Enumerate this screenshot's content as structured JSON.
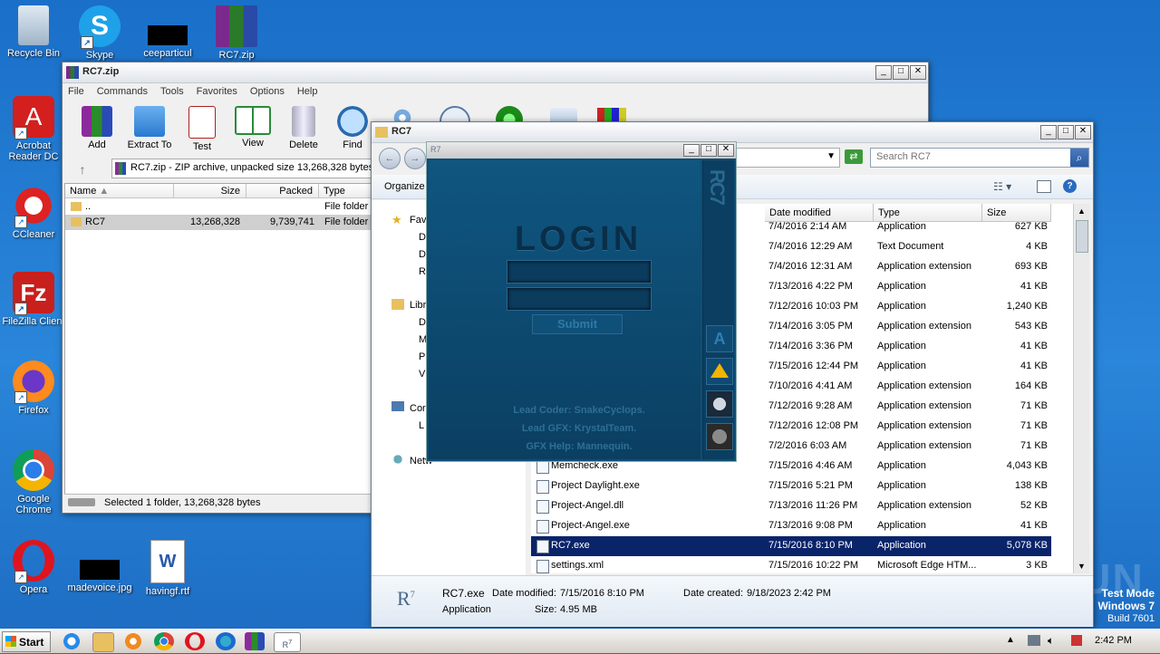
{
  "desktop": {
    "icons": [
      {
        "label": "Recycle Bin"
      },
      {
        "label": "Skype"
      },
      {
        "label": "ceeparticul"
      },
      {
        "label": "RC7.zip"
      },
      {
        "label": "Acrobat Reader DC"
      },
      {
        "label": "CCleaner"
      },
      {
        "label": "FileZilla Client"
      },
      {
        "label": "Firefox"
      },
      {
        "label": "Google Chrome"
      },
      {
        "label": "Opera"
      },
      {
        "label": "madevoice.jpg"
      },
      {
        "label": "havingf.rtf"
      }
    ],
    "watermark": {
      "brand": "ANY RUN",
      "mode": "Test Mode",
      "os": "Windows 7",
      "build": "Build 7601"
    }
  },
  "winrar": {
    "title": "RC7.zip",
    "menu": [
      "File",
      "Commands",
      "Tools",
      "Favorites",
      "Options",
      "Help"
    ],
    "toolbar": [
      "Add",
      "Extract To",
      "Test",
      "View",
      "Delete",
      "Find"
    ],
    "address": "RC7.zip - ZIP archive, unpacked size 13,268,328 bytes",
    "columns": [
      "Name",
      "Size",
      "Packed",
      "Type"
    ],
    "rows": [
      {
        "name": "..",
        "size": "",
        "packed": "",
        "type": "File folder"
      },
      {
        "name": "RC7",
        "size": "13,268,328",
        "packed": "9,739,741",
        "type": "File folder"
      }
    ],
    "status": "Selected 1 folder, 13,268,328 bytes"
  },
  "explorer": {
    "title": "RC7",
    "search_placeholder": "Search RC7",
    "organize": "Organize",
    "columns": [
      "Date modified",
      "Type",
      "Size"
    ],
    "nav": [
      "Fav",
      "D",
      "D",
      "R",
      "Libr",
      "D",
      "M",
      "P",
      "V",
      "Cor",
      "L",
      "Netw"
    ],
    "files": [
      {
        "name": "",
        "date": "7/4/2016 2:14 AM",
        "type": "Application",
        "size": "627 KB"
      },
      {
        "name": "",
        "date": "7/4/2016 12:29 AM",
        "type": "Text Document",
        "size": "4 KB"
      },
      {
        "name": "",
        "date": "7/4/2016 12:31 AM",
        "type": "Application extension",
        "size": "693 KB"
      },
      {
        "name": "",
        "date": "7/13/2016 4:22 PM",
        "type": "Application",
        "size": "41 KB"
      },
      {
        "name": "",
        "date": "7/12/2016 10:03 PM",
        "type": "Application",
        "size": "1,240 KB"
      },
      {
        "name": "",
        "date": "7/14/2016 3:05 PM",
        "type": "Application extension",
        "size": "543 KB"
      },
      {
        "name": "",
        "date": "7/14/2016 3:36 PM",
        "type": "Application",
        "size": "41 KB"
      },
      {
        "name": "",
        "date": "7/15/2016 12:44 PM",
        "type": "Application",
        "size": "41 KB"
      },
      {
        "name": "",
        "date": "7/10/2016 4:41 AM",
        "type": "Application extension",
        "size": "164 KB"
      },
      {
        "name": "",
        "date": "7/12/2016 9:28 AM",
        "type": "Application extension",
        "size": "71 KB"
      },
      {
        "name": "",
        "date": "7/12/2016 12:08 PM",
        "type": "Application extension",
        "size": "71 KB"
      },
      {
        "name": "",
        "date": "7/2/2016 6:03 AM",
        "type": "Application extension",
        "size": "71 KB"
      },
      {
        "name": "Memcheck.exe",
        "date": "7/15/2016 4:46 AM",
        "type": "Application",
        "size": "4,043 KB"
      },
      {
        "name": "Project Daylight.exe",
        "date": "7/15/2016 5:21 PM",
        "type": "Application",
        "size": "138 KB"
      },
      {
        "name": "Project-Angel.dll",
        "date": "7/13/2016 11:26 PM",
        "type": "Application extension",
        "size": "52 KB"
      },
      {
        "name": "Project-Angel.exe",
        "date": "7/13/2016 9:08 PM",
        "type": "Application",
        "size": "41 KB"
      },
      {
        "name": "RC7.exe",
        "date": "7/15/2016 8:10 PM",
        "type": "Application",
        "size": "5,078 KB"
      },
      {
        "name": "settings.xml",
        "date": "7/15/2016 10:22 PM",
        "type": "Microsoft Edge HTM...",
        "size": "3 KB"
      }
    ],
    "details": {
      "name": "RC7.exe",
      "modified_label": "Date modified:",
      "modified": "7/15/2016 8:10 PM",
      "created_label": "Date created:",
      "created": "9/18/2023 2:42 PM",
      "type": "Application",
      "size_label": "Size:",
      "size": "4.95 MB"
    }
  },
  "login": {
    "title_icon": "R7",
    "heading": "LOGIN",
    "submit": "Submit",
    "side_logo": "RC7",
    "credits": [
      "Lead Coder: SnakeCyclops.",
      "Lead GFX: KrystalTeam.",
      "GFX Help: Mannequin."
    ],
    "side_buttons": [
      "A"
    ]
  },
  "taskbar": {
    "start": "Start",
    "clock": "2:42 PM"
  }
}
